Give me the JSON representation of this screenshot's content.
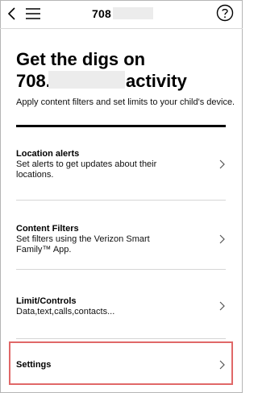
{
  "header": {
    "title": "708",
    "back_icon": "back-chevron-icon",
    "menu_icon": "hamburger-menu-icon",
    "help_icon": "help-circle-icon"
  },
  "hero": {
    "title_line1": "Get the digs on",
    "title_prefix": "708.",
    "title_suffix": "activity",
    "description": "Apply content filters and set limits to your child's device."
  },
  "menu": {
    "items": [
      {
        "title": "Location alerts",
        "subtitle": "Set alerts to get updates about their locations."
      },
      {
        "title": "Content Filters",
        "subtitle": "Set filters using the Verizon Smart Family™ App."
      },
      {
        "title": "Limit/Controls",
        "subtitle": "Data,text,calls,contacts..."
      },
      {
        "title": "Settings",
        "subtitle": ""
      }
    ]
  },
  "colors": {
    "highlight_border": "#e06868",
    "accent_rule": "#000000"
  }
}
